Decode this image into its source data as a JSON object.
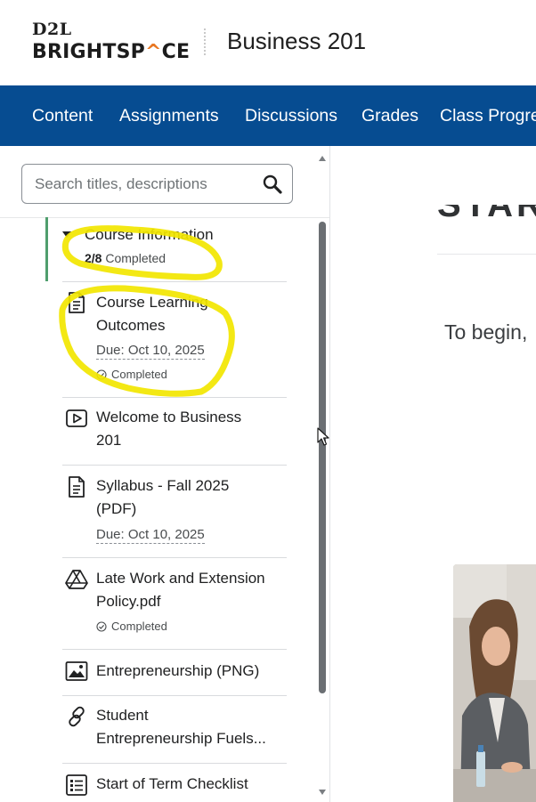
{
  "header": {
    "logo_top": "D2L",
    "logo_bottom_pre": "BRIGHTSP",
    "logo_bottom_mark": "^",
    "logo_bottom_post": "CE",
    "course_title": "Business 201"
  },
  "nav": {
    "items": [
      "Content",
      "Assignments",
      "Discussions",
      "Grades",
      "Class Progre"
    ]
  },
  "search": {
    "placeholder": "Search titles, descriptions"
  },
  "module": {
    "title": "Course Information",
    "progress_count": "2/8",
    "progress_label": "Completed"
  },
  "items": [
    {
      "icon": "document-icon",
      "title_line1": "Course Learning",
      "title_line2": "Outcomes",
      "due": "Due: Oct 10, 2025",
      "status": "Completed"
    },
    {
      "icon": "video-icon",
      "title_line1": "Welcome to Business",
      "title_line2": "201"
    },
    {
      "icon": "document-icon",
      "title_line1": "Syllabus - Fall 2025",
      "title_line2": "(PDF)",
      "due": "Due: Oct 10, 2025"
    },
    {
      "icon": "google-drive-icon",
      "title_line1": "Late Work and Extension",
      "title_line2": "Policy.pdf",
      "status": "Completed"
    },
    {
      "icon": "image-icon",
      "title_line1": "Entrepreneurship (PNG)"
    },
    {
      "icon": "link-icon",
      "title_line1": "Student",
      "title_line2": "Entrepreneurship Fuels..."
    },
    {
      "icon": "checklist-icon",
      "title_line1": "Start of Term Checklist"
    }
  ],
  "content": {
    "begin_text": "To begin,"
  },
  "colors": {
    "nav_bg": "#064c91",
    "module_bar": "#4f9e6d",
    "highlighter": "#f2e600"
  }
}
